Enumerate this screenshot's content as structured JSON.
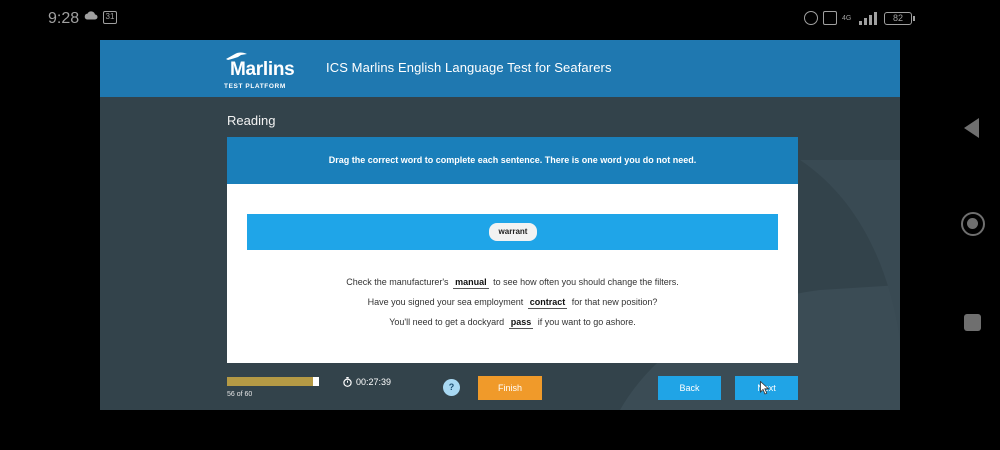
{
  "status_bar": {
    "time": "9:28",
    "calendar_day": "31",
    "network_label": "4G",
    "battery": "82"
  },
  "header": {
    "logo_word": "Marlins",
    "logo_sub": "TEST PLATFORM",
    "title": "ICS Marlins English Language Test for Seafarers"
  },
  "section": {
    "title": "Reading"
  },
  "question": {
    "instruction": "Drag the correct word to complete each sentence. There is one word you do not need.",
    "word_bank": [
      "warrant"
    ],
    "sentences": [
      {
        "before": "Check the manufacturer's",
        "answer": "manual",
        "after": "to see how often you should change the filters."
      },
      {
        "before": "Have you signed your sea employment",
        "answer": "contract",
        "after": "for that new position?"
      },
      {
        "before": "You'll need to get a dockyard",
        "answer": "pass",
        "after": "if you want to go ashore."
      }
    ]
  },
  "footer": {
    "progress_label": "56 of 60",
    "progress_fraction": 0.9333,
    "timer": "00:27:39",
    "help_label": "?",
    "finish_label": "Finish",
    "back_label": "Back",
    "next_label": "Next"
  },
  "colors": {
    "header": "#1f78b0",
    "card_head": "#1a7fba",
    "drag_bar": "#1fa5e8",
    "finish": "#f09a2a",
    "nav_button": "#20a4e6",
    "progress": "#b59a45",
    "background": "#33434b"
  }
}
